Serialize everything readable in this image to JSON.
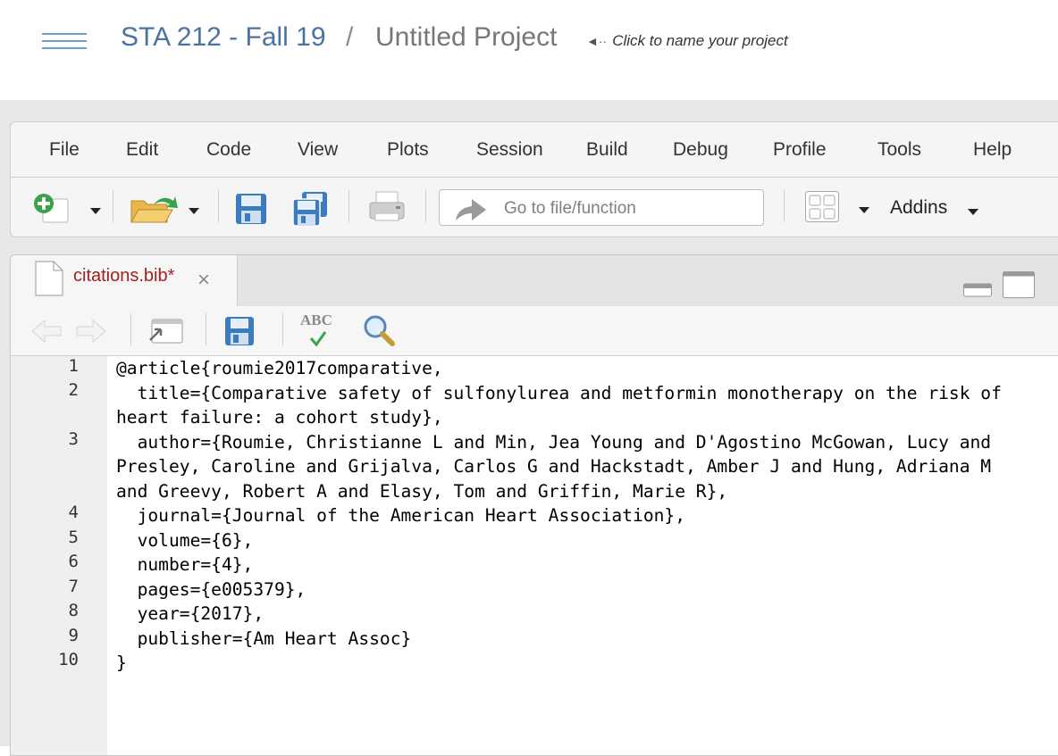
{
  "header": {
    "course": "STA 212 - Fall 19",
    "separator": "/",
    "project": "Untitled Project",
    "hint": "Click to name your project"
  },
  "menu": [
    "File",
    "Edit",
    "Code",
    "View",
    "Plots",
    "Session",
    "Build",
    "Debug",
    "Profile",
    "Tools",
    "Help"
  ],
  "toolbar": {
    "goto_placeholder": "Go to file/function",
    "addins_label": "Addins"
  },
  "editor": {
    "tab_label": "citations.bib*",
    "close_glyph": "×",
    "spellcheck_label": "ABC",
    "line_numbers": [
      "1",
      "2",
      "3",
      "4",
      "5",
      "6",
      "7",
      "8",
      "9",
      "10"
    ],
    "lines": [
      "@article{roumie2017comparative,",
      "  title={Comparative safety of sulfonylurea and metformin monotherapy on the risk of",
      "heart failure: a cohort study},",
      "  author={Roumie, Christianne L and Min, Jea Young and D'Agostino McGowan, Lucy and",
      "Presley, Caroline and Grijalva, Carlos G and Hackstadt, Amber J and Hung, Adriana M",
      "and Greevy, Robert A and Elasy, Tom and Griffin, Marie R},",
      "  journal={Journal of the American Heart Association},",
      "  volume={6},",
      "  number={4},",
      "  pages={e005379},",
      "  year={2017},",
      "  publisher={Am Heart Assoc}",
      "}"
    ]
  },
  "colors": {
    "course_link": "#4a73a0",
    "tab_modified": "#a3211c",
    "accent_green": "#3aa34a",
    "save_blue": "#3d7bbf"
  }
}
